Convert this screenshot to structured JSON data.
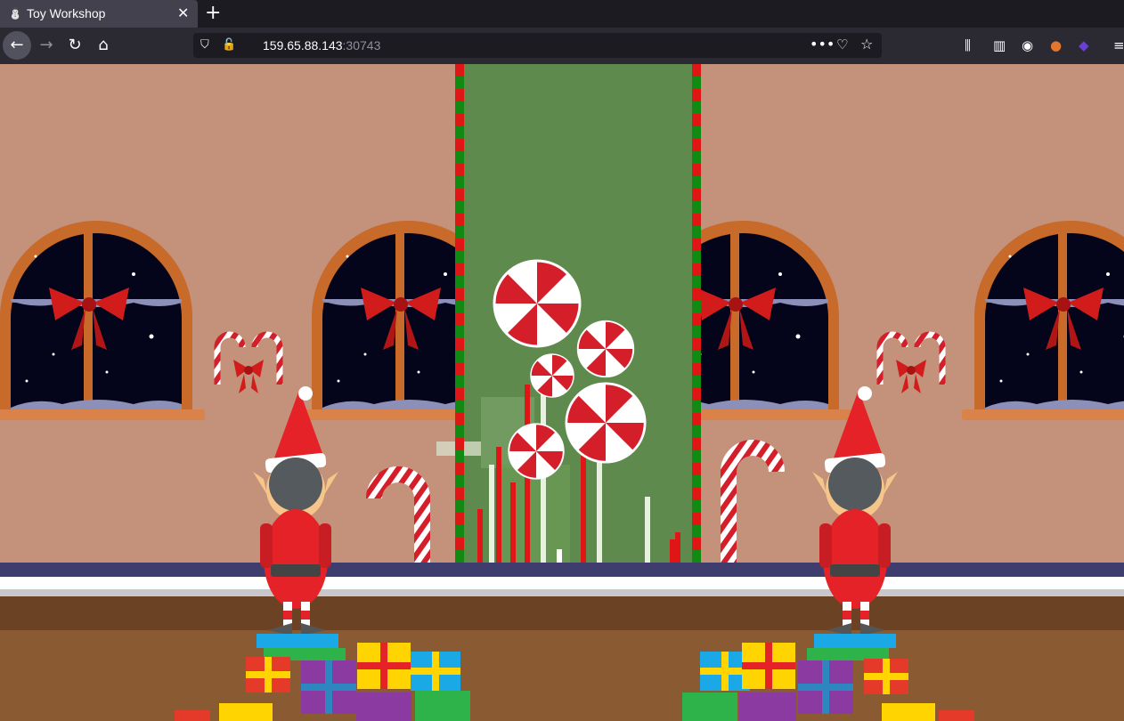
{
  "tab": {
    "title": "Toy Workshop",
    "close": "✕",
    "new_tab": "+"
  },
  "navbar": {
    "back": "←",
    "forward": "→",
    "reload": "↻",
    "home": "⌂",
    "url_host": "159.65.88.143",
    "url_port": ":30743",
    "page_menu": "•••",
    "pocket": "♡",
    "bookmark": "☆"
  },
  "toolbar_icons": [
    "library-icon",
    "sidebar-icon",
    "account-icon",
    "extension-icon",
    "extension-cube-icon",
    "menu-icon"
  ],
  "colors": {
    "wall": "#c4917a",
    "frame": "#c86a2a",
    "night": "#04041a",
    "bow": "#d21c1c",
    "elf_red": "#e52227",
    "floor": "#8a5a32",
    "stripe_green": "#118a11",
    "panel": "#5e8a4e"
  }
}
